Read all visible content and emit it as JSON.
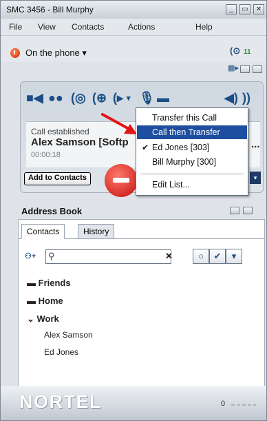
{
  "window": {
    "title": "SMC 3456 - Bill Murphy"
  },
  "menu": {
    "file": "File",
    "view": "View",
    "contacts": "Contacts",
    "actions": "Actions",
    "help": "Help"
  },
  "status": {
    "label": "On the phone",
    "voicemail_count": "11"
  },
  "call": {
    "status": "Call established",
    "party": "Alex Samson [Softp",
    "overflow": "...",
    "duration": "00:00:18",
    "add_to_contacts": "Add to Contacts"
  },
  "transfer_menu": {
    "items": [
      "Transfer this Call",
      "Call then Transfer",
      "Ed Jones [303]",
      "Bill Murphy [300]",
      "Edit List..."
    ],
    "selected_index": 1,
    "checked_index": 2
  },
  "address_book": {
    "title": "Address Book",
    "tabs": [
      "Contacts",
      "History"
    ],
    "active_tab": "Contacts",
    "search_value": "",
    "groups": [
      "Friends",
      "Home",
      "Work"
    ],
    "work_contacts": [
      "Alex Samson",
      "Ed Jones"
    ]
  },
  "footer": {
    "brand": "NORTEL",
    "volume_label": "0"
  },
  "colors": {
    "accent_blue": "#1a4e86",
    "menu_highlight": "#1e4ea0",
    "call_end_red": "#c20d0d",
    "status_orange": "#d62a0a"
  }
}
